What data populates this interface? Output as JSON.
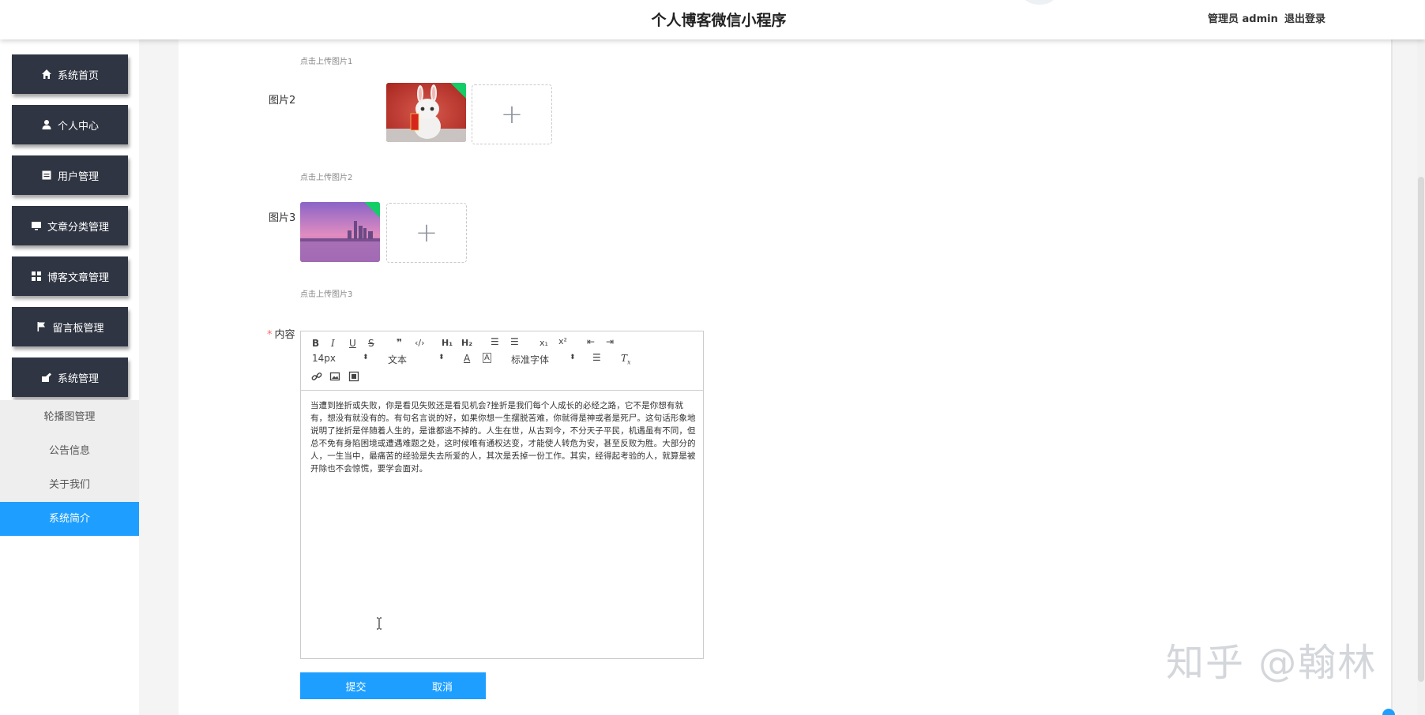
{
  "header": {
    "title": "个人博客微信小程序",
    "user": "管理员 admin",
    "logout": "退出登录"
  },
  "sidebar": {
    "items": [
      {
        "label": "系统首页",
        "icon": "home-icon"
      },
      {
        "label": "个人中心",
        "icon": "user-icon"
      },
      {
        "label": "用户管理",
        "icon": "list-icon"
      },
      {
        "label": "文章分类管理",
        "icon": "monitor-icon"
      },
      {
        "label": "博客文章管理",
        "icon": "grid-icon"
      },
      {
        "label": "留言板管理",
        "icon": "flag-icon"
      },
      {
        "label": "系统管理",
        "icon": "settings-icon"
      }
    ],
    "submenu": [
      {
        "label": "轮播图管理"
      },
      {
        "label": "公告信息"
      },
      {
        "label": "关于我们"
      },
      {
        "label": "系统简介",
        "active": true
      }
    ]
  },
  "form": {
    "hint1": "点击上传图片1",
    "image2_label": "图片2",
    "hint2": "点击上传图片2",
    "image3_label": "图片3",
    "hint3": "点击上传图片3",
    "content_required": "*",
    "content_label": "内容",
    "editor": {
      "font_size": "14px",
      "header_select": "文本",
      "font_family": "标准字体",
      "text": "当遭到挫折或失败，你是看见失败还是看见机会?挫折是我们每个人成长的必经之路，它不是你想有就有，想没有就没有的。有句名言说的好，如果你想一生摆脱苦难，你就得是神或者是死尸。这句话形象地说明了挫折是伴随着人生的，是谁都逃不掉的。人生在世，从古到今，不分天子平民，机遇虽有不同，但总不免有身陷困境或遭遇难题之处，这时候唯有通权达变，才能使人转危为安，甚至反败为胜。大部分的人，一生当中，最痛苦的经验是失去所爱的人，其次是丢掉一份工作。其实，经得起考验的人，就算是被开除也不会惊慌，要学会面对。"
    },
    "submit": "提交",
    "cancel": "取消"
  },
  "watermark": "知乎 @翰林",
  "colors": {
    "accent": "#1e9fff",
    "sidebar_dark": "#2f3542",
    "badge_green": "#13ce66"
  }
}
